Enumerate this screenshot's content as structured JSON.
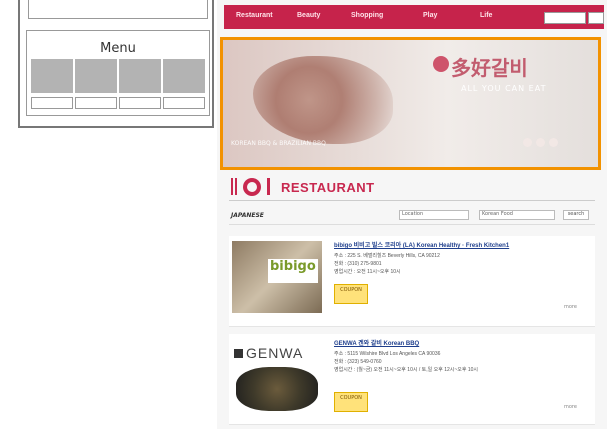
{
  "wireframe": {
    "menu_label": "Menu"
  },
  "nav": {
    "items": [
      "Restaurant",
      "Beauty",
      "Shopping",
      "Play",
      "Life"
    ]
  },
  "banner": {
    "logo_korean": "多好갈비",
    "logo_tagline": "ALL YOU CAN EAT",
    "caption": "KOREAN BBQ & BRAZILIAN BBQ",
    "colors": {
      "accent_border": "#f29200",
      "brand_red": "#c6234b"
    }
  },
  "section": {
    "title": "RESTAURANT",
    "icon": "utensils-plate-icon"
  },
  "filters": {
    "category_label": "JAPANESE",
    "location_value": "Location",
    "type_value": "Korean Food",
    "search_label": "search"
  },
  "listings": [
    {
      "title": "bibigo 비비고 빌스 코리아 (LA) Korean Healthy · Fresh Kitchen1",
      "lines": [
        "주소 : 225 S. 베벌리힐즈 Beverly Hills, CA 90212",
        "전화 : (310) 275-9801",
        "영업시간 : 오전 11시~오후 10시"
      ],
      "thumb_text": "bibigo",
      "coupon_label": "COUPON",
      "more_label": "more"
    },
    {
      "title": "GENWA 겐와 갈비 Korean BBQ",
      "lines": [
        "주소 : 5115 Wilshire Blvd Los Angeles CA 90036",
        "전화 : (323) 549-0760",
        "영업시간 : (월~금) 오전 11시~오후 10시 / 토,일 오후 12시~오후 10시"
      ],
      "thumb_text": "GENWA",
      "coupon_label": "COUPON",
      "more_label": "more"
    }
  ]
}
